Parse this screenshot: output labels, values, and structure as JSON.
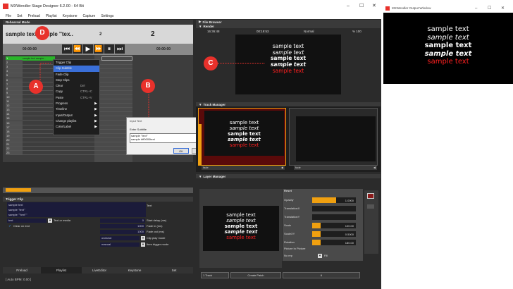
{
  "app": {
    "title": "MXWendler Stage Designer 6.2.00 - 64 Bit"
  },
  "menu": [
    "File",
    "Set",
    "Preload",
    "Playlist",
    "Keystone",
    "Capture",
    "Settings"
  ],
  "rehearsal": {
    "header": "Rehearsal Mode",
    "clip_name": "sample text sample ''tex..",
    "clip_num": "2",
    "next_num": "2",
    "time_left": "00:00:00",
    "time_right": "00:00:00"
  },
  "context_menu": {
    "items": [
      {
        "label": "Trigger Clip"
      },
      {
        "label": "Clip Subtitle"
      },
      {
        "label": "Fade Clip"
      },
      {
        "label": "Stop Clips"
      },
      {
        "label": "Clear",
        "shortcut": "Del"
      },
      {
        "label": "Copy",
        "shortcut": "CTRL+C"
      },
      {
        "label": "Paste",
        "shortcut": "CTRL+V"
      },
      {
        "label": "Progress"
      },
      {
        "label": "Timeline"
      },
      {
        "label": "Input/Output"
      },
      {
        "label": "Change playlist"
      },
      {
        "label": "Color/Label"
      }
    ],
    "arrow": "▶"
  },
  "grid": {
    "rows": [
      "1",
      "2",
      "3",
      "4",
      "5",
      "6",
      "7",
      "8",
      "9",
      "10",
      "11",
      "12",
      "13",
      "14",
      "15",
      "16",
      "17",
      "18",
      "19",
      "20",
      "21",
      "22",
      "23"
    ],
    "first_cell": "sample text sample..."
  },
  "dialog": {
    "title": "Input Text",
    "prompt": "Enter Subtitle",
    "lines": [
      "sample ''text''",
      "sample #ff0000text"
    ],
    "ok": "OK",
    "cancel": "Cancel"
  },
  "markers": {
    "a": "A",
    "b": "B",
    "c": "C",
    "d": "D"
  },
  "file_browser": {
    "header": "File Browser"
  },
  "render": {
    "header": "Render",
    "time1": "16:36:48",
    "time2": "00:19:53",
    "mode": "Normal",
    "zoom": "% 100"
  },
  "sample_lines": [
    "sample text",
    "sample text",
    "sample text",
    "sample text",
    "sample text"
  ],
  "track_manager": {
    "header": "Track Manager",
    "fade1": "fade",
    "fade2": "fade"
  },
  "layer_manager": {
    "header": "Layer Manager",
    "reset": "Reset",
    "params": [
      {
        "label": "Opacity",
        "value": "1.0000",
        "level": 0.55
      },
      {
        "label": "TranslationX",
        "value": "",
        "level": 0
      },
      {
        "label": "TranslationY",
        "value": "",
        "level": 0
      },
      {
        "label": "Scale",
        "value": "100.00",
        "level": 0.2
      },
      {
        "label": "ScaleXY",
        "value": "0.5000",
        "level": 0.2
      },
      {
        "label": "Rotation",
        "value": "180.00",
        "level": 0.2
      }
    ],
    "pip": "Picture In Picture",
    "norep": "No rep",
    "fill": "Fill",
    "track_btn": "1 Track",
    "create_patch": "Create Patch",
    "patch_num": "6"
  },
  "trigger": {
    "header": "Trigger Clip",
    "lines": [
      "sample text",
      "sample ''text''",
      "sample ''''text''''"
    ],
    "text_label": "Text",
    "field_text": "text",
    "field_text_label": "Text or media",
    "clear_on_end": "Clear on end",
    "start_delay": "0",
    "start_delay_label": "Start delay (ms)",
    "fade_in": "1000",
    "fade_in_label": "Fade in (ms)",
    "fade_out": "1000",
    "fade_out_label": "Fade out (ms)",
    "play_mode": "oneshot",
    "play_mode_label": "Clip play mode",
    "trigger_mode": "manual",
    "trigger_mode_label": "Item trigger mode"
  },
  "tabs": [
    "Preload",
    "Playlist",
    "LiveEditor",
    "Keystone",
    "Set"
  ],
  "status": "[ Auto BPM: 0.00 ]",
  "output": {
    "title": "MXWendler Output Window"
  },
  "colors": {
    "accent_orange": "#f0a010",
    "red": "#e8312b",
    "blue_select": "#3a6fd8"
  }
}
